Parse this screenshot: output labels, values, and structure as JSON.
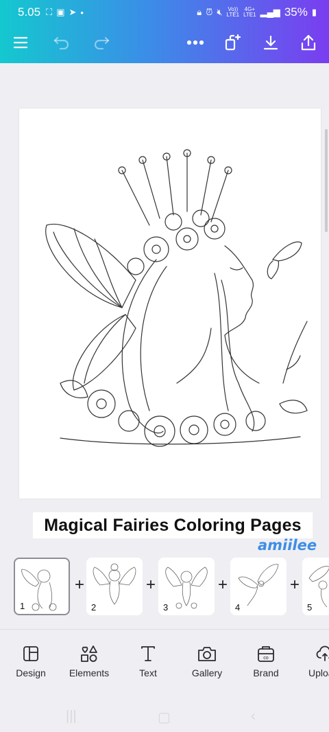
{
  "status_bar": {
    "time": "5.05",
    "network_top": "Vo))",
    "network_bottom": "LTE1",
    "network_type_top": "4G+",
    "network_type_bottom": "LTE1",
    "battery": "35%",
    "icons": [
      "screenshot-icon",
      "gallery-icon",
      "telegram-icon",
      "dot-icon",
      "lock-icon",
      "alarm-icon",
      "mute-icon",
      "signal-icon",
      "battery-icon"
    ]
  },
  "toolbar": {
    "items": [
      "menu-icon",
      "undo-icon",
      "redo-icon",
      "more-icon",
      "magic-resize-icon",
      "download-icon",
      "share-icon"
    ]
  },
  "design": {
    "title": "Magical Fairies Coloring Pages",
    "signature": "amiilee"
  },
  "pages": [
    {
      "number": "1",
      "selected": true
    },
    {
      "number": "2",
      "selected": false
    },
    {
      "number": "3",
      "selected": false
    },
    {
      "number": "4",
      "selected": false
    },
    {
      "number": "5",
      "selected": false
    }
  ],
  "add_page_symbol": "+",
  "bottom_nav": [
    {
      "label": "Design",
      "icon": "design-icon"
    },
    {
      "label": "Elements",
      "icon": "elements-icon"
    },
    {
      "label": "Text",
      "icon": "text-icon"
    },
    {
      "label": "Gallery",
      "icon": "camera-icon"
    },
    {
      "label": "Brand",
      "icon": "brand-icon"
    },
    {
      "label": "Uploa",
      "icon": "upload-icon"
    }
  ],
  "system_nav": [
    "recents-icon",
    "home-icon",
    "back-icon"
  ],
  "colors": {
    "header_start": "#14c8cf",
    "header_end": "#7a3df0",
    "signature": "#3d8ee6",
    "background": "#efeff3"
  }
}
